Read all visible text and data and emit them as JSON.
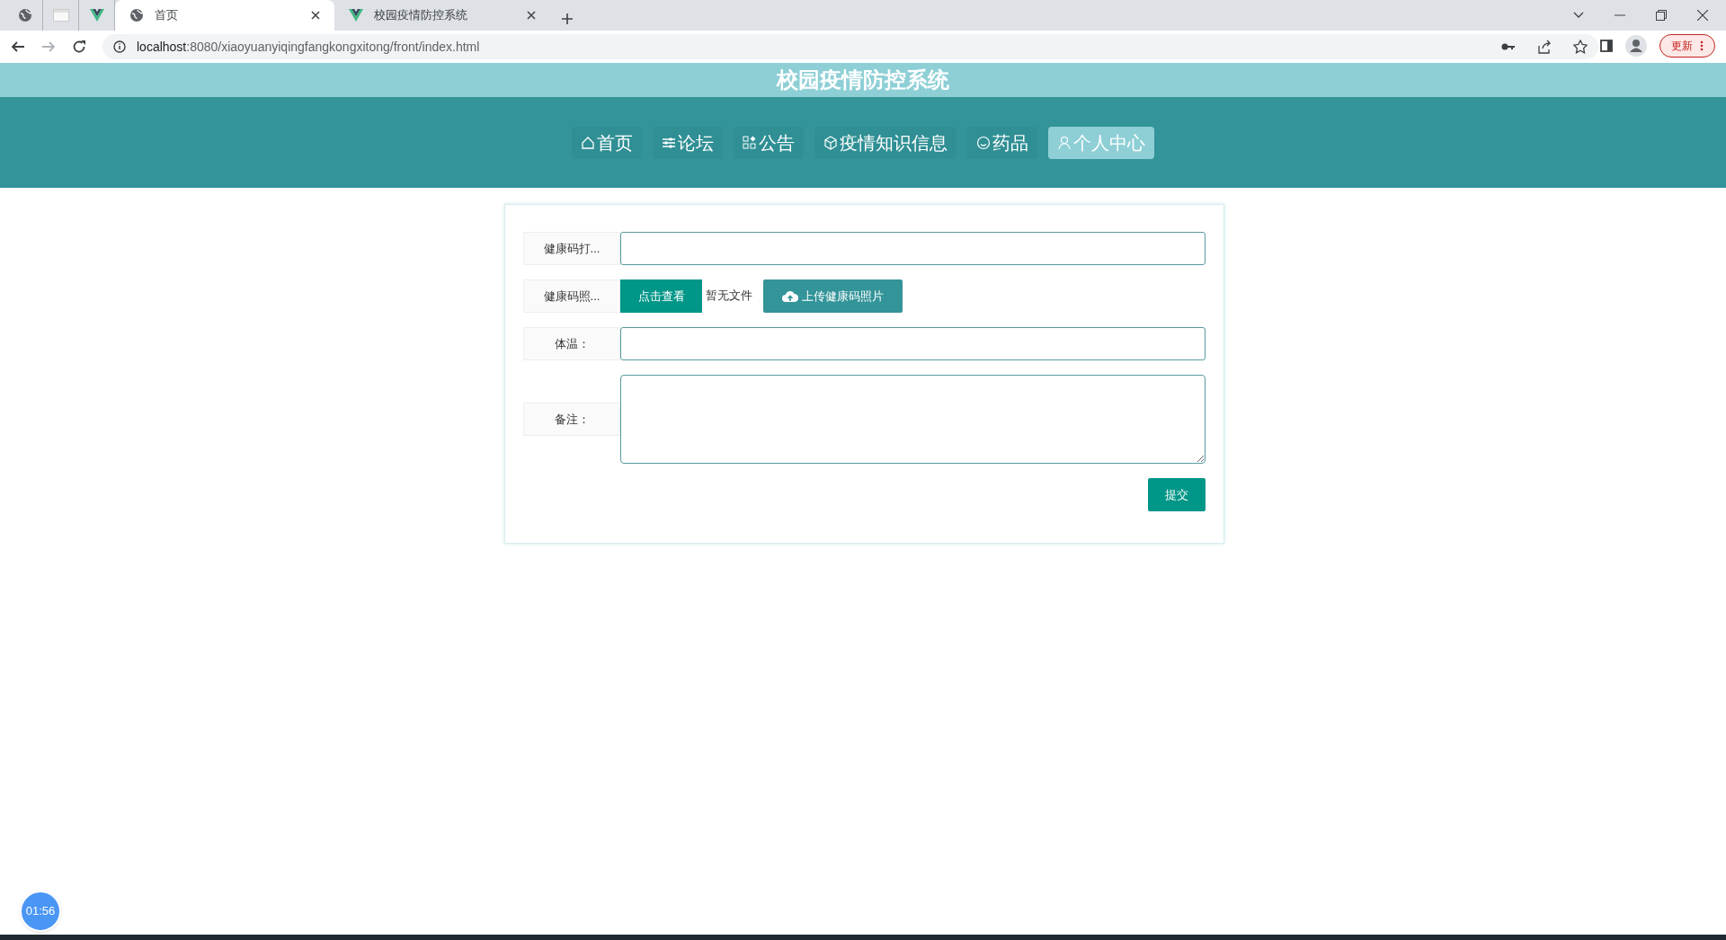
{
  "browser": {
    "tabs": [
      {
        "kind": "globe",
        "selected": false
      },
      {
        "kind": "blank",
        "selected": false
      },
      {
        "kind": "vue",
        "selected": false
      },
      {
        "kind": "globe",
        "label": "首页",
        "selected": true
      },
      {
        "kind": "vue",
        "label": "校园疫情防控系统",
        "selected": false
      }
    ],
    "url_host": "localhost",
    "url_rest": ":8080/xiaoyuanyiqingfangkongxitong/front/index.html",
    "update_button": "更新"
  },
  "site_title": "校园疫情防控系统",
  "nav": [
    {
      "kind": "home",
      "label": "首页",
      "selected": false
    },
    {
      "kind": "sliders",
      "label": "论坛",
      "selected": false
    },
    {
      "kind": "grid",
      "label": "公告",
      "selected": false
    },
    {
      "kind": "cube",
      "label": "疫情知识信息",
      "selected": false
    },
    {
      "kind": "smile",
      "label": "药品",
      "selected": false
    },
    {
      "kind": "user",
      "label": "个人中心",
      "selected": true
    }
  ],
  "form": {
    "fields": [
      {
        "kind": "input",
        "label": "健康码打..."
      },
      {
        "kind": "upload",
        "label": "健康码照...",
        "view_button": "点击查看",
        "file_status": "暂无文件",
        "upload_button": "上传健康码照片"
      },
      {
        "kind": "input",
        "label": "体温："
      },
      {
        "kind": "textarea",
        "label": "备注："
      }
    ],
    "submit": "提交"
  },
  "timer": "01:56"
}
